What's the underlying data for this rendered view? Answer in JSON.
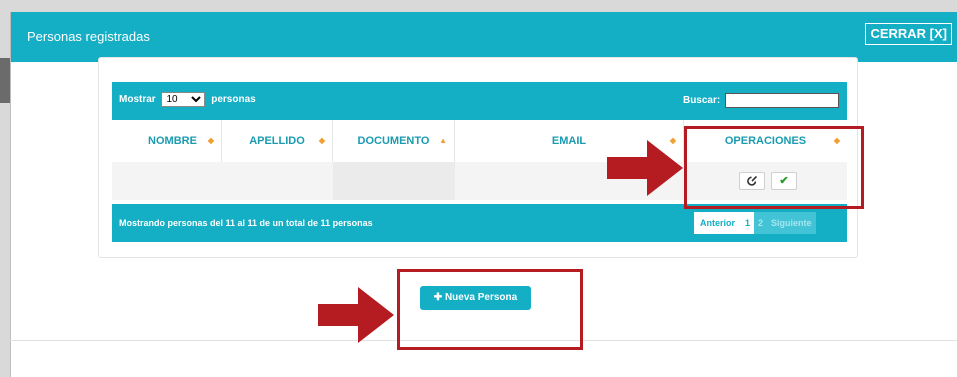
{
  "modal": {
    "title": "Personas registradas",
    "close_label": "CERRAR [X]"
  },
  "table_controls": {
    "show_prefix": "Mostrar",
    "show_value": "10",
    "show_suffix": "personas",
    "search_label": "Buscar:",
    "search_value": ""
  },
  "table": {
    "columns": [
      "NOMBRE",
      "APELLIDO",
      "DOCUMENTO",
      "EMAIL",
      "OPERACIONES"
    ],
    "sorted_column": "DOCUMENTO",
    "row": {
      "nombre": "",
      "apellido": "",
      "documento": "",
      "email": ""
    },
    "operations": [
      "edit-icon",
      "check-icon"
    ]
  },
  "table_footer": {
    "info": "Mostrando personas del 11 al 11 de un total de 11 personas",
    "pagination": {
      "prev": "Anterior",
      "pages": [
        "1",
        "2"
      ],
      "next": "Siguiente"
    }
  },
  "actions": {
    "new_person": "Nueva Persona"
  },
  "colors": {
    "accent": "#14aec5",
    "highlight": "#b51c22",
    "sort_icon": "#f0a030"
  }
}
